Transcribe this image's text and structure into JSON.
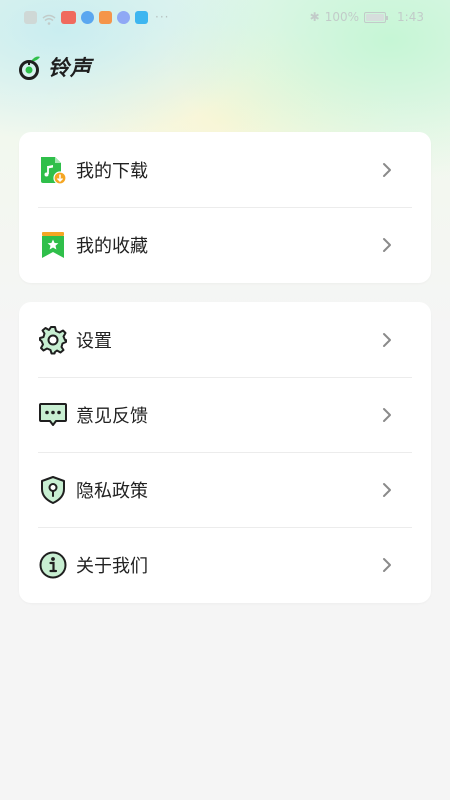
{
  "status_bar": {
    "battery_text": "100%",
    "time": "1:43",
    "notification_icons": [
      "notification-icon",
      "wifi-icon",
      "app-red-icon",
      "app-blue-icon",
      "app-orange-icon",
      "music-icon",
      "search-icon"
    ]
  },
  "header": {
    "title": "铃声"
  },
  "card1": {
    "items": [
      {
        "label": "我的下载",
        "icon": "music-download-icon"
      },
      {
        "label": "我的收藏",
        "icon": "bookmark-star-icon"
      }
    ]
  },
  "card2": {
    "items": [
      {
        "label": "设置",
        "icon": "gear-icon"
      },
      {
        "label": "意见反馈",
        "icon": "feedback-chat-icon"
      },
      {
        "label": "隐私政策",
        "icon": "shield-icon"
      },
      {
        "label": "关于我们",
        "icon": "info-icon"
      }
    ]
  },
  "colors": {
    "accent_green": "#2fbf4a",
    "accent_orange": "#f5a623",
    "text": "#222222",
    "chevron": "#8a8a8a"
  }
}
